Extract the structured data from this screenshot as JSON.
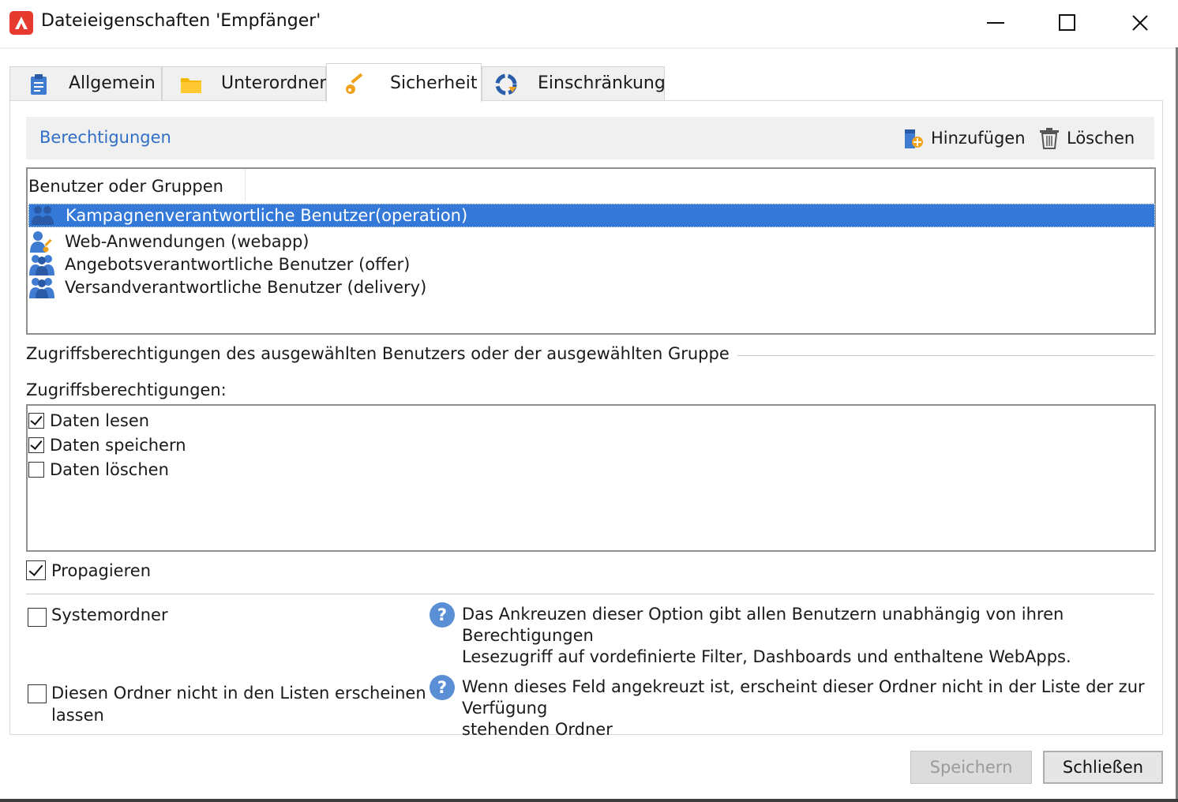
{
  "window": {
    "title": "Dateieigenschaften 'Empfänger'",
    "brand_color": "#e63a2e"
  },
  "tabs": [
    {
      "label": "Allgemein",
      "icon": "clipboard-icon"
    },
    {
      "label": "Unterordner",
      "icon": "folder-icon"
    },
    {
      "label": "Sicherheit",
      "icon": "key-icon",
      "active": true
    },
    {
      "label": "Einschränkung",
      "icon": "restriction-icon"
    }
  ],
  "permissions": {
    "title": "Berechtigungen",
    "add_label": "Hinzufügen",
    "delete_label": "Löschen",
    "column_header": "Benutzer oder Gruppen",
    "items": [
      {
        "label": "Kampagnenverantwortliche Benutzer(operation)",
        "icon": "user-group-icon",
        "selected": true
      },
      {
        "label": "Web-Anwendungen (webapp)",
        "icon": "user-key-icon",
        "selected": false
      },
      {
        "label": "Angebotsverantwortliche Benutzer (offer)",
        "icon": "user-group-icon",
        "selected": false
      },
      {
        "label": "Versandverantwortliche Benutzer (delivery)",
        "icon": "user-group-icon",
        "selected": false
      }
    ]
  },
  "access": {
    "section_title": "Zugriffsberechtigungen des ausgewählten Benutzers oder der ausgewählten Gruppe",
    "label": "Zugriffsberechtigungen:",
    "rights": [
      {
        "label": "Daten lesen",
        "checked": true
      },
      {
        "label": "Daten speichern",
        "checked": true
      },
      {
        "label": "Daten löschen",
        "checked": false
      }
    ]
  },
  "propagate": {
    "label": "Propagieren",
    "checked": true
  },
  "system_folder": {
    "label": "Systemordner",
    "checked": false,
    "help_line1": "Das Ankreuzen dieser Option gibt allen Benutzern unabhängig von ihren Berechtigungen",
    "help_line2": "Lesezugriff auf vordefinierte Filter, Dashboards und enthaltene WebApps."
  },
  "hide_folder": {
    "label_line1": "Diesen Ordner nicht in den Listen erscheinen",
    "label_line2": "lassen",
    "checked": false,
    "help_line1": "Wenn dieses Feld angekreuzt ist, erscheint dieser Ordner nicht in der Liste der zur Verfügung",
    "help_line2": "stehenden Ordner"
  },
  "buttons": {
    "save_label": "Speichern",
    "close_label": "Schließen"
  },
  "colors": {
    "selection": "#3479d8",
    "link": "#2f6fc7",
    "help": "#5a8fd6"
  }
}
